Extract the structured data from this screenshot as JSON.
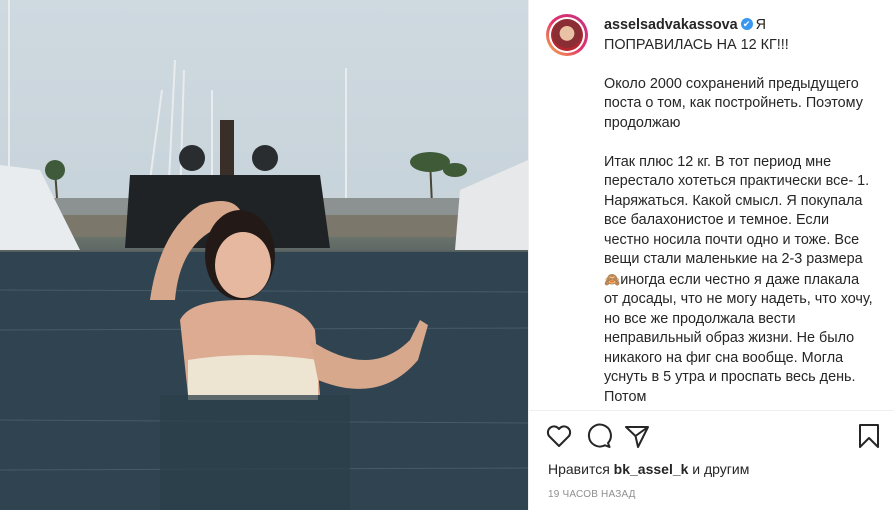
{
  "post": {
    "username": "asselsadvakassova",
    "verified_glyph": "✔",
    "caption_first": "Я ПОПРАВИЛАСЬ НА 12 КГ!!!",
    "paragraph2": "Около 2000 сохранений предыдущего поста о том, как постройнеть. Поэтому продолжаю",
    "paragraph3_part1": "Итак плюс 12 кг. В тот период мне перестало хотеться практически все- 1. Наряжаться. Какой смысл. Я покупала все балахонистое и темное. Если честно носила почти одно и тоже. Все вещи стали маленькие на 2-3 размера",
    "emoji": "🙈",
    "paragraph3_part2": "иногда если честно я даже плакала от досады, что не могу надеть, что хочу, но все же продолжала вести неправильный образ жизни. Не было никакого на фиг сна вообще. Могла уснуть в 5 утра и проспать весь день. Потом"
  },
  "actions": {
    "like_icon": "heart-outline",
    "comment_icon": "comment-bubble",
    "share_icon": "paper-plane",
    "save_icon": "bookmark"
  },
  "likes": {
    "prefix": "Нравится",
    "user": "bk_assel_k",
    "suffix": "и другим"
  },
  "timestamp": "19 часов назад",
  "colors": {
    "verified": "#3897f0",
    "text": "#262626",
    "muted": "#8e8e8e"
  }
}
